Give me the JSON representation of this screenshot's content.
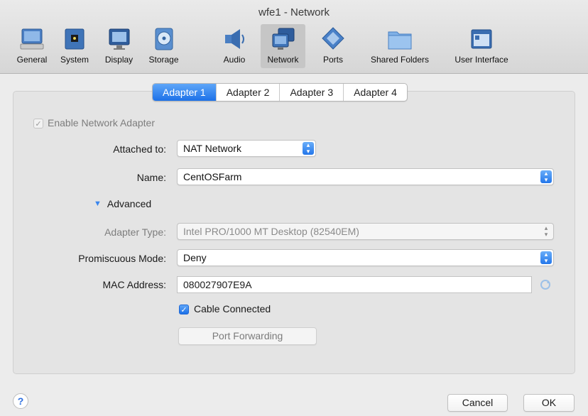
{
  "window": {
    "title": "wfe1 - Network"
  },
  "toolbar": {
    "items": [
      {
        "label": "General",
        "icon": "general-icon"
      },
      {
        "label": "System",
        "icon": "system-icon"
      },
      {
        "label": "Display",
        "icon": "display-icon"
      },
      {
        "label": "Storage",
        "icon": "storage-icon"
      },
      {
        "label": "Audio",
        "icon": "audio-icon"
      },
      {
        "label": "Network",
        "icon": "network-icon",
        "selected": true
      },
      {
        "label": "Ports",
        "icon": "ports-icon"
      },
      {
        "label": "Shared Folders",
        "icon": "shared-folders-icon"
      },
      {
        "label": "User Interface",
        "icon": "user-interface-icon"
      }
    ]
  },
  "tabs": [
    "Adapter 1",
    "Adapter 2",
    "Adapter 3",
    "Adapter 4"
  ],
  "active_tab": "Adapter 1",
  "form": {
    "enable_adapter_label": "Enable Network Adapter",
    "attached_to": {
      "label": "Attached to:",
      "value": "NAT Network"
    },
    "name": {
      "label": "Name:",
      "value": "CentOSFarm"
    },
    "advanced_label": "Advanced",
    "adapter_type": {
      "label": "Adapter Type:",
      "value": "Intel PRO/1000 MT Desktop (82540EM)"
    },
    "promiscuous_mode": {
      "label": "Promiscuous Mode:",
      "value": "Deny"
    },
    "mac_address": {
      "label": "MAC Address:",
      "value": "080027907E9A"
    },
    "cable_connected_label": "Cable Connected",
    "port_forwarding_label": "Port Forwarding"
  },
  "footer": {
    "help_label": "?",
    "cancel_label": "Cancel",
    "ok_label": "OK"
  },
  "colors": {
    "accent": "#1d71e8",
    "window_bg": "#ececec",
    "panel_bg": "#e4e4e4"
  }
}
